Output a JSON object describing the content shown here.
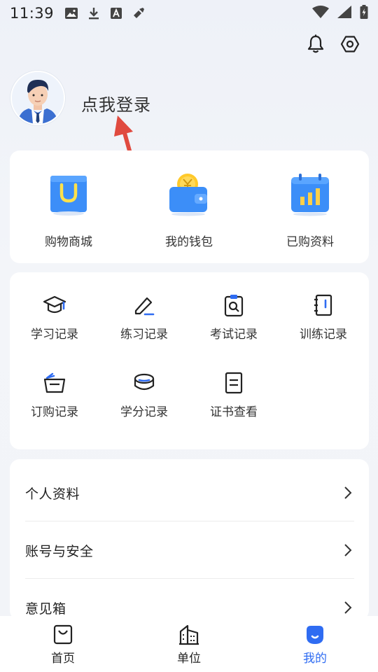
{
  "status_bar": {
    "time": "11:39",
    "left_icons": [
      "image-icon",
      "download-icon",
      "font-icon",
      "tool-icon"
    ],
    "right_icons": [
      "wifi-icon",
      "signal-icon",
      "battery-icon"
    ]
  },
  "header": {
    "icons": [
      "bell-icon",
      "settings-icon"
    ]
  },
  "profile": {
    "login_text": "点我登录"
  },
  "quick_actions": [
    {
      "label": "购物商城",
      "icon": "shopping-bag-icon"
    },
    {
      "label": "我的钱包",
      "icon": "wallet-icon"
    },
    {
      "label": "已购资料",
      "icon": "calendar-chart-icon"
    }
  ],
  "records": [
    {
      "label": "学习记录",
      "icon": "graduation-cap-icon"
    },
    {
      "label": "练习记录",
      "icon": "pencil-icon"
    },
    {
      "label": "考试记录",
      "icon": "clipboard-search-icon"
    },
    {
      "label": "训练记录",
      "icon": "notebook-icon"
    },
    {
      "label": "订购记录",
      "icon": "basket-icon"
    },
    {
      "label": "学分记录",
      "icon": "coins-icon"
    },
    {
      "label": "证书查看",
      "icon": "certificate-icon"
    }
  ],
  "settings": [
    {
      "label": "个人资料"
    },
    {
      "label": "账号与安全"
    },
    {
      "label": "意见箱"
    }
  ],
  "bottom_nav": [
    {
      "label": "首页",
      "icon": "bag-icon",
      "active": false
    },
    {
      "label": "单位",
      "icon": "building-icon",
      "active": false
    },
    {
      "label": "我的",
      "icon": "profile-icon",
      "active": true
    }
  ],
  "colors": {
    "accent": "#2f6cf2",
    "annotation_arrow": "#e04a3f"
  }
}
